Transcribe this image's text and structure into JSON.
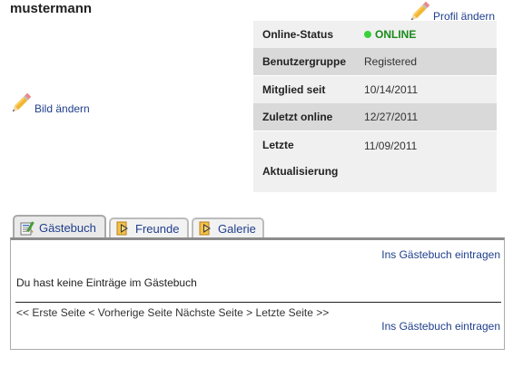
{
  "profile": {
    "username": "mustermann",
    "edit_profile_label": "Profil ändern",
    "edit_picture_label": "Bild ändern"
  },
  "info": {
    "rows": [
      {
        "label": "Online-Status",
        "value": "ONLINE"
      },
      {
        "label": "Benutzergruppe",
        "value": "Registered"
      },
      {
        "label": "Mitglied seit",
        "value": "10/14/2011"
      },
      {
        "label": "Zuletzt online",
        "value": "12/27/2011"
      },
      {
        "label": "Letzte Aktualisierung",
        "value": "11/09/2011"
      }
    ]
  },
  "tabs": [
    {
      "label": "Gästebuch",
      "icon": "guestbook-icon",
      "active": true
    },
    {
      "label": "Freunde",
      "icon": "arrow-tab-icon",
      "active": false
    },
    {
      "label": "Galerie",
      "icon": "arrow-tab-icon",
      "active": false
    }
  ],
  "guestbook": {
    "add_entry_label": "Ins Gästebuch eintragen",
    "empty_message": "Du hast keine Einträge im Gästebuch",
    "pager": {
      "first": "<< Erste Seite",
      "prev": "< Vorherige Seite",
      "next": "Nächste Seite >",
      "last": "Letzte Seite >>"
    }
  },
  "colors": {
    "link": "#1f3e8c",
    "online": "#1a8a1a",
    "online_dot": "#3bd13b"
  }
}
